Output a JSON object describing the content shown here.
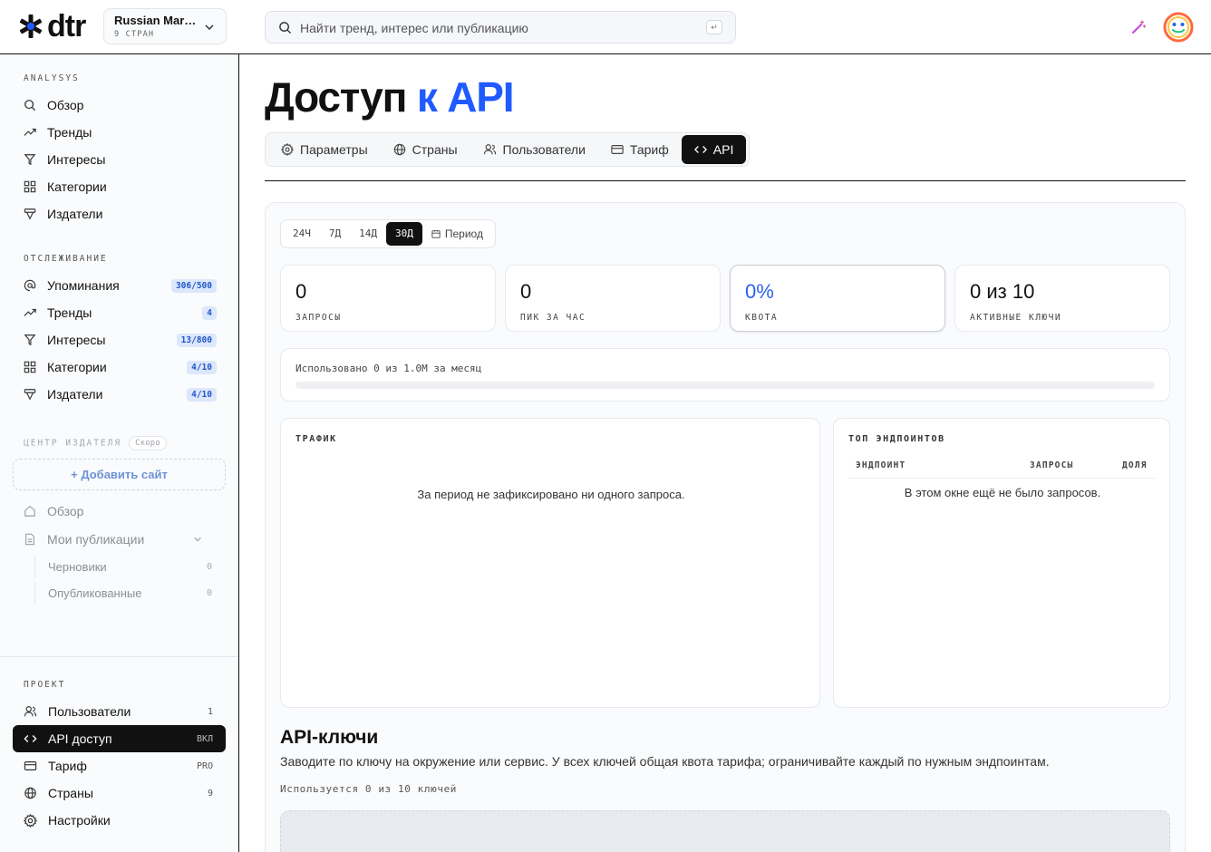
{
  "brand": {
    "logo_text": "dtr"
  },
  "project": {
    "name": "Russian Mar…",
    "subtitle": "9 СТРАН"
  },
  "search": {
    "placeholder": "Найти тренд, интерес или публикацию",
    "shortcut": "↵"
  },
  "sidebar": {
    "analysis_label": "ANALYSYS",
    "analysis_items": [
      {
        "label": "Обзор",
        "icon": "search-icon"
      },
      {
        "label": "Тренды",
        "icon": "trend-icon"
      },
      {
        "label": "Интересы",
        "icon": "filter-icon"
      },
      {
        "label": "Категории",
        "icon": "grid-icon"
      },
      {
        "label": "Издатели",
        "icon": "publishers-icon"
      }
    ],
    "tracking_label": "ОТСЛЕЖИВАНИЕ",
    "tracking_items": [
      {
        "label": "Упоминания",
        "badge": "306/500",
        "icon": "at-icon"
      },
      {
        "label": "Тренды",
        "badge": "4",
        "icon": "trend-icon"
      },
      {
        "label": "Интересы",
        "badge": "13/800",
        "icon": "filter-icon"
      },
      {
        "label": "Категории",
        "badge": "4/10",
        "icon": "grid-icon"
      },
      {
        "label": "Издатели",
        "badge": "4/10",
        "icon": "publishers-icon"
      }
    ],
    "publisher_label": "ЦЕНТР ИЗДАТЕЛЯ",
    "publisher_soon": "Скоро",
    "add_site": "+ Добавить сайт",
    "publisher_items": [
      {
        "label": "Обзор",
        "icon": "home-icon"
      },
      {
        "label": "Мои публикации",
        "icon": "document-icon"
      }
    ],
    "publication_subitems": [
      {
        "label": "Черновики",
        "count": "0"
      },
      {
        "label": "Опубликованные",
        "count": "0"
      }
    ],
    "project_label": "ПРОЕКТ",
    "project_items": [
      {
        "label": "Пользователи",
        "count": "1",
        "icon": "users-icon"
      },
      {
        "label": "API доступ",
        "count": "ВКЛ",
        "icon": "code-icon",
        "active": true
      },
      {
        "label": "Тариф",
        "count": "PRO",
        "icon": "card-icon"
      },
      {
        "label": "Страны",
        "count": "9",
        "icon": "globe-icon"
      },
      {
        "label": "Настройки",
        "count": "",
        "icon": "gear-icon"
      }
    ]
  },
  "page": {
    "title_plain": "Доступ",
    "title_accent": "к API",
    "accent_color": "#1f5bff",
    "tabs": [
      {
        "label": "Параметры",
        "icon": "gear-icon"
      },
      {
        "label": "Страны",
        "icon": "globe-icon"
      },
      {
        "label": "Пользователи",
        "icon": "users-icon"
      },
      {
        "label": "Тариф",
        "icon": "card-icon"
      },
      {
        "label": "API",
        "icon": "code-icon",
        "active": true
      }
    ]
  },
  "ranges": [
    {
      "label": "24Ч"
    },
    {
      "label": "7Д"
    },
    {
      "label": "14Д"
    },
    {
      "label": "30Д",
      "active": true
    },
    {
      "label": "Период",
      "icon": "calendar-icon"
    }
  ],
  "stats": [
    {
      "value": "0",
      "label": "ЗАПРОСЫ"
    },
    {
      "value": "0",
      "label": "ПИК ЗА ЧАС"
    },
    {
      "value": "0%",
      "label": "КВОТА"
    },
    {
      "value": "0 из 10",
      "label": "АКТИВНЫЕ КЛЮЧИ"
    }
  ],
  "usage": {
    "text": "Использовано 0 из 1.0M за месяц",
    "fraction": 0
  },
  "traffic": {
    "title": "ТРАФИК",
    "empty": "За период не зафиксировано ни одного запроса."
  },
  "endpoints": {
    "title": "ТОП ЭНДПОИНТОВ",
    "columns": [
      "ЭНДПОИНТ",
      "ЗАПРОСЫ",
      "ДОЛЯ"
    ],
    "empty": "В этом окне ещё не было запросов."
  },
  "keys": {
    "title": "API-ключи",
    "description": "Заводите по ключу на окружение или сервис. У всех ключей общая квота тарифа; ограничивайте каждый по нужным эндпоинтам.",
    "used": "Используется 0 из 10 ключей"
  }
}
